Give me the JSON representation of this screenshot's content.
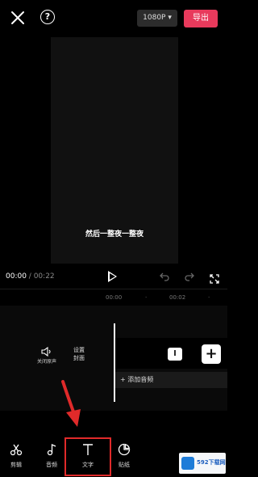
{
  "header": {
    "resolution": "1080P ▾",
    "export_label": "导出"
  },
  "preview": {
    "subtitle": "然后一整夜一整夜"
  },
  "playback": {
    "current_time": "00:00",
    "separator": " / ",
    "total_time": "00:22"
  },
  "ruler": {
    "ticks": [
      "00:00",
      "·",
      "00:02",
      "·"
    ]
  },
  "timeline": {
    "mute_label": "关闭原声",
    "cover_label": "设置封面",
    "add_audio_label": "+ 添加音频",
    "split_label": "I",
    "add_clip_label": "+"
  },
  "toolbar": {
    "items": [
      {
        "label": "剪辑",
        "icon": "scissors-icon"
      },
      {
        "label": "音频",
        "icon": "music-note-icon"
      },
      {
        "label": "文字",
        "icon": "text-icon"
      },
      {
        "label": "贴纸",
        "icon": "sticker-icon"
      }
    ]
  },
  "watermark": {
    "text": "592下载网"
  },
  "colors": {
    "export_accent": "#e83a5c",
    "highlight": "#e02a2a"
  }
}
